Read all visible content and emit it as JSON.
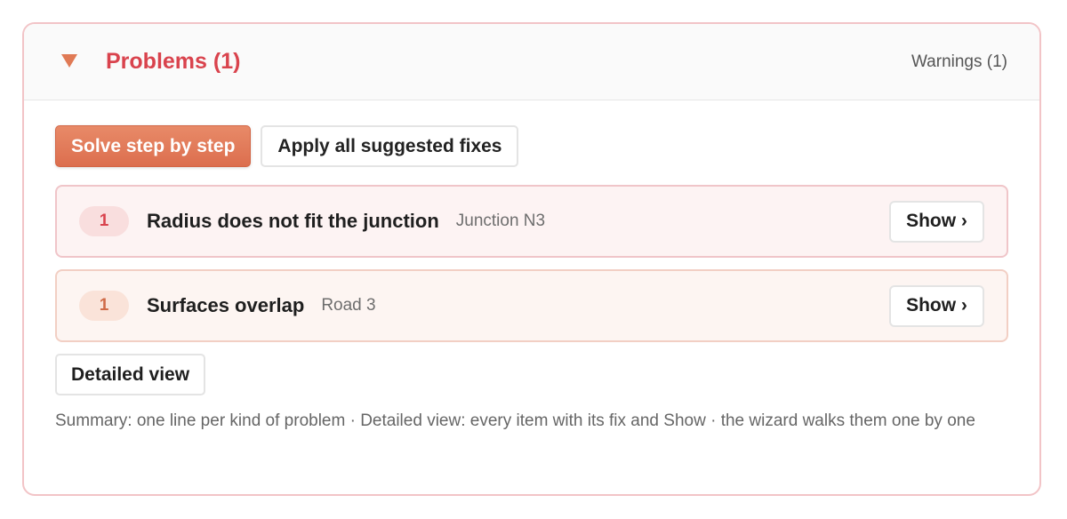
{
  "panel": {
    "title": "Problems (1)",
    "warnings_label": "Warnings (1)",
    "caret_icon": "triangle-down-icon"
  },
  "actions": {
    "solve_label": "Solve step by step",
    "apply_label": "Apply all suggested fixes"
  },
  "problems": [
    {
      "count": "1",
      "title": "Radius does not fit the junction",
      "target": "Junction N3",
      "show_label": "Show ›",
      "severity_color": "#d9434d"
    },
    {
      "count": "1",
      "title": "Surfaces overlap",
      "target": "Road 3",
      "show_label": "Show ›",
      "severity_color": "#cf6b48"
    }
  ],
  "detailed_view_label": "Detailed view",
  "summary_text": "Summary: one line per kind of problem · Detailed view: every item with its fix and Show · the wizard walks them one by one",
  "colors": {
    "accent": "#dc6e4e",
    "error": "#d9434d",
    "border": "#f2c4c7"
  }
}
